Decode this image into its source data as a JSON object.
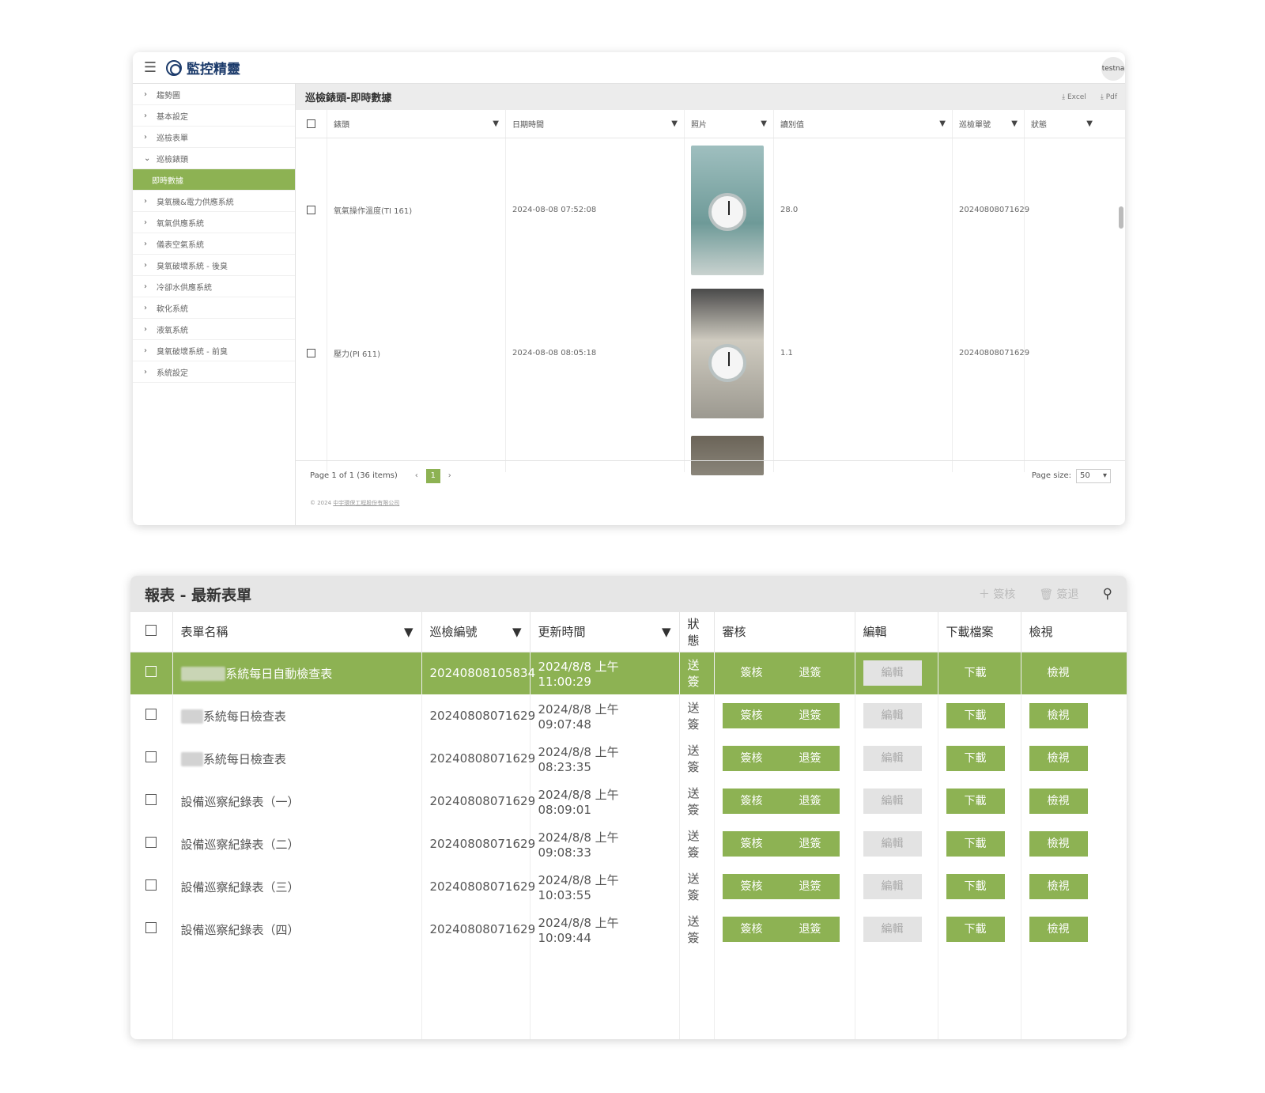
{
  "panel1": {
    "app_title": "監控精靈",
    "user": "testna",
    "sidebar": [
      {
        "label": "趨勢圖",
        "expanded": false
      },
      {
        "label": "基本設定",
        "expanded": false
      },
      {
        "label": "巡檢表單",
        "expanded": false
      },
      {
        "label": "巡檢錶頭",
        "expanded": true
      },
      {
        "label": "即時數據",
        "active": true
      },
      {
        "label": "臭氧機&電力供應系統",
        "expanded": false
      },
      {
        "label": "氧氣供應系統",
        "expanded": false
      },
      {
        "label": "儀表空氣系統",
        "expanded": false
      },
      {
        "label": "臭氧破壞系統 - 後臭",
        "expanded": false
      },
      {
        "label": "冷卻水供應系統",
        "expanded": false
      },
      {
        "label": "軟化系統",
        "expanded": false
      },
      {
        "label": "液氧系統",
        "expanded": false
      },
      {
        "label": "臭氧破壞系統 - 前臭",
        "expanded": false
      },
      {
        "label": "系統設定",
        "expanded": false
      }
    ],
    "page_title": "巡檢錶頭-即時數據",
    "export_excel": "Excel",
    "export_pdf": "Pdf",
    "columns": [
      "錶頭",
      "日期時間",
      "照片",
      "讀別值",
      "巡檢單號",
      "狀態"
    ],
    "rows": [
      {
        "name": "氧氣操作溫度(TI 161)",
        "datetime": "2024-08-08 07:52:08",
        "value": "28.0",
        "form_no": "20240808071629",
        "status": ""
      },
      {
        "name": "壓力(PI 611)",
        "datetime": "2024-08-08 08:05:18",
        "value": "1.1",
        "form_no": "20240808071629",
        "status": ""
      }
    ],
    "pager": {
      "summary": "Page 1 of 1 (36 items)",
      "current_page": "1",
      "page_size_label": "Page size:",
      "page_size": "50"
    },
    "footer": "© 2024",
    "footer_link": "中宇環保工程股份有限公司"
  },
  "panel2": {
    "title": "報表 - 最新表單",
    "tool_sign": "簽核",
    "tool_return": "簽退",
    "columns": {
      "form_name": "表單名稱",
      "form_no": "巡檢編號",
      "updated": "更新時間",
      "status": "狀態",
      "review": "審核",
      "edit": "編輯",
      "download": "下載檔案",
      "view": "檢視"
    },
    "btn_sign": "簽核",
    "btn_return": "退簽",
    "btn_edit": "編輯",
    "btn_download": "下載",
    "btn_view": "檢視",
    "rows": [
      {
        "redacted": "■■■■",
        "name": "系統每日自動檢查表",
        "form_no": "20240808105834",
        "updated": "2024/8/8 上午 11:00:29",
        "status": "送簽",
        "selected": true
      },
      {
        "redacted": "■■",
        "name": "系統每日檢查表",
        "form_no": "20240808071629",
        "updated": "2024/8/8 上午 09:07:48",
        "status": "送簽"
      },
      {
        "redacted": "■■",
        "name": "系統每日檢查表",
        "form_no": "20240808071629",
        "updated": "2024/8/8 上午 08:23:35",
        "status": "送簽"
      },
      {
        "redacted": "",
        "name": "設備巡察紀錄表（一）",
        "form_no": "20240808071629",
        "updated": "2024/8/8 上午 08:09:01",
        "status": "送簽"
      },
      {
        "redacted": "",
        "name": "設備巡察紀錄表（二）",
        "form_no": "20240808071629",
        "updated": "2024/8/8 上午 09:08:33",
        "status": "送簽"
      },
      {
        "redacted": "",
        "name": "設備巡察紀錄表（三）",
        "form_no": "20240808071629",
        "updated": "2024/8/8 上午 10:03:55",
        "status": "送簽"
      },
      {
        "redacted": "",
        "name": "設備巡察紀錄表（四）",
        "form_no": "20240808071629",
        "updated": "2024/8/8 上午 10:09:44",
        "status": "送簽"
      }
    ]
  },
  "colors": {
    "accent": "#8db253",
    "brand": "#1c3b6b",
    "disabled": "#e3e3e3"
  }
}
